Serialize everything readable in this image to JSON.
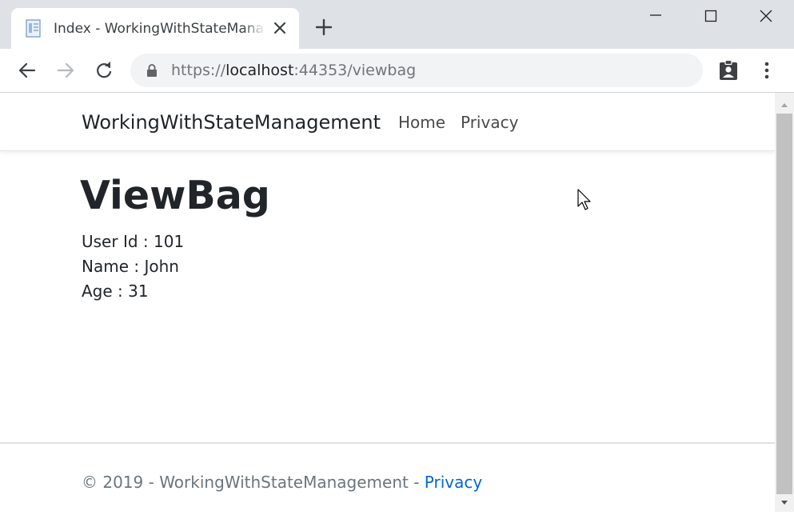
{
  "browser": {
    "tab": {
      "title": "Index - WorkingWithStateManagement"
    },
    "address_bar": {
      "scheme": "https://",
      "host": "localhost",
      "rest": ":44353/viewbag"
    }
  },
  "navbar": {
    "brand": "WorkingWithStateManagement",
    "links": [
      "Home",
      "Privacy"
    ]
  },
  "main": {
    "heading": "ViewBag",
    "lines": [
      "User Id : 101",
      "Name : John",
      "Age : 31"
    ]
  },
  "footer": {
    "text": "© 2019 - WorkingWithStateManagement - ",
    "link": "Privacy"
  },
  "colors": {
    "tabstrip": "#dee1e6",
    "link": "#0366d6",
    "text": "#212529",
    "footer_text": "#6c757d"
  },
  "icons": [
    "document-icon",
    "close-icon",
    "plus-icon",
    "minimize-icon",
    "maximize-icon",
    "window-close-icon",
    "back-arrow-icon",
    "forward-arrow-icon",
    "reload-icon",
    "lock-icon",
    "profile-icon",
    "more-vert-icon",
    "mouse-cursor-icon"
  ]
}
